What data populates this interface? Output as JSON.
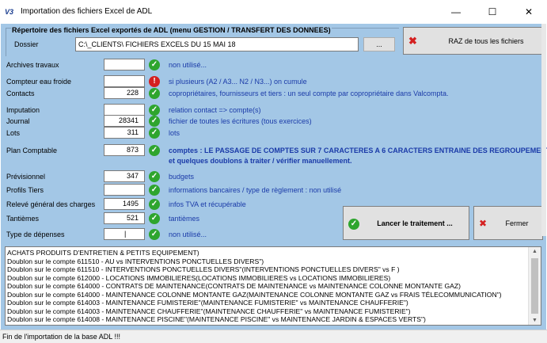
{
  "window": {
    "icon_text": "V3",
    "title": "Importation des fichiers Excel de ADL",
    "minimize": "—",
    "maximize": "☐",
    "close": "✕"
  },
  "directory": {
    "legend": "Répertoire des fichiers Excel exportés de ADL  (menu GESTION / TRANSFERT DES DONNEES)",
    "dossier_label": "Dossier",
    "dossier_value": "C:\\_CLIENTS\\                    FICHIERS EXCELS DU 15 MAI 18",
    "browse_label": "..."
  },
  "raz_button": {
    "label": "RAZ de tous les fichiers",
    "icon": "red-x-icon"
  },
  "rows": [
    {
      "label": "Archives travaux",
      "value": "",
      "status": "ok",
      "desc": "non utilisé...",
      "bold": false
    },
    {
      "label": "Compteur eau froide",
      "value": "",
      "status": "warn",
      "desc": "si plusieurs (A2 / A3... N2 / N3...) on cumule",
      "bold": false
    },
    {
      "label": "Contacts",
      "value": "228",
      "status": "ok",
      "desc": "copropriétaires, fournisseurs et tiers : un seul compte par copropriétaire dans Valcompta.",
      "bold": false
    },
    {
      "label": "Imputation",
      "value": "",
      "status": "ok",
      "desc": "relation contact => compte(s)",
      "bold": false
    },
    {
      "label": "Journal",
      "value": "28341",
      "status": "ok",
      "desc": "fichier de toutes les écritures (tous exercices)",
      "bold": false
    },
    {
      "label": "Lots",
      "value": "311",
      "status": "ok",
      "desc": "lots",
      "bold": false
    },
    {
      "label": "Plan Comptable",
      "value": "873",
      "status": "ok",
      "desc": "comptes : LE PASSAGE DE COMPTES SUR 7 CARACTERES A 6 CARACTERS ENTRAINE DES REGROUPEMENTS",
      "desc2": "et quelques doublons à traiter / vérifier manuellement.",
      "bold": true
    },
    {
      "label": "Prévisionnel",
      "value": "347",
      "status": "ok",
      "desc": "budgets",
      "bold": false
    },
    {
      "label": "Profils Tiers",
      "value": "",
      "status": "ok",
      "desc": "informations bancaires / type de règlement : non utilisé",
      "bold": false
    },
    {
      "label": "Relevé général des charges",
      "value": "1495",
      "status": "ok",
      "desc": "infos TVA et récupérable",
      "bold": false
    },
    {
      "label": "Tantièmes",
      "value": "521",
      "status": "ok",
      "desc": "tantièmes",
      "bold": false
    },
    {
      "label": "Type de dépenses",
      "value": "|",
      "status": "ok",
      "desc": "non utilisé...",
      "bold": false
    }
  ],
  "launch_button": {
    "label": "Lancer le traitement ..."
  },
  "close_button": {
    "label": "Fermer"
  },
  "log": [
    "ACHATS PRODUITS D'ENTRETIEN & PETITS EQUIPEMENT)",
    "Doublon sur le compte 611510 -                        AU vs INTERVENTIONS PONCTUELLES DIVERS\")",
    "Doublon sur le compte 611510 - INTERVENTIONS PONCTUELLES DIVERS\"(INTERVENTIONS PONCTUELLES DIVERS\" vs F         )",
    "Doublon sur le compte 612000 - LOCATIONS IMMOBILIERES(LOCATIONS IMMOBILIERES vs LOCATIONS IMMOBILIERES)",
    "Doublon sur le compte 614000 - CONTRATS DE MAINTENANCE(CONTRATS DE MAINTENANCE vs MAINTENANCE COLONNE MONTANTE GAZ)",
    "Doublon sur le compte 614000 - MAINTENANCE COLONNE MONTANTE GAZ(MAINTENANCE COLONNE MONTANTE GAZ vs FRAIS TÉLECOMMUNICATION\")",
    "Doublon sur le compte 614003 - MAINTENANCE FUMISTERIE\"(MAINTENANCE FUMISTERIE\" vs MAINTENANCE CHAUFFERIE\")",
    "Doublon sur le compte 614003 - MAINTENANCE CHAUFFERIE\"(MAINTENANCE CHAUFFERIE\" vs MAINTENANCE FUMISTERIE\")",
    "Doublon sur le compte 614008 - MAINTENANCE PISCINE\"(MAINTENANCE PISCINE\" vs MAINTENANCE JARDIN & ESPACES VERTS\")"
  ],
  "status_bar": {
    "text": "Fin de l'importation de la base ADL !!!"
  }
}
